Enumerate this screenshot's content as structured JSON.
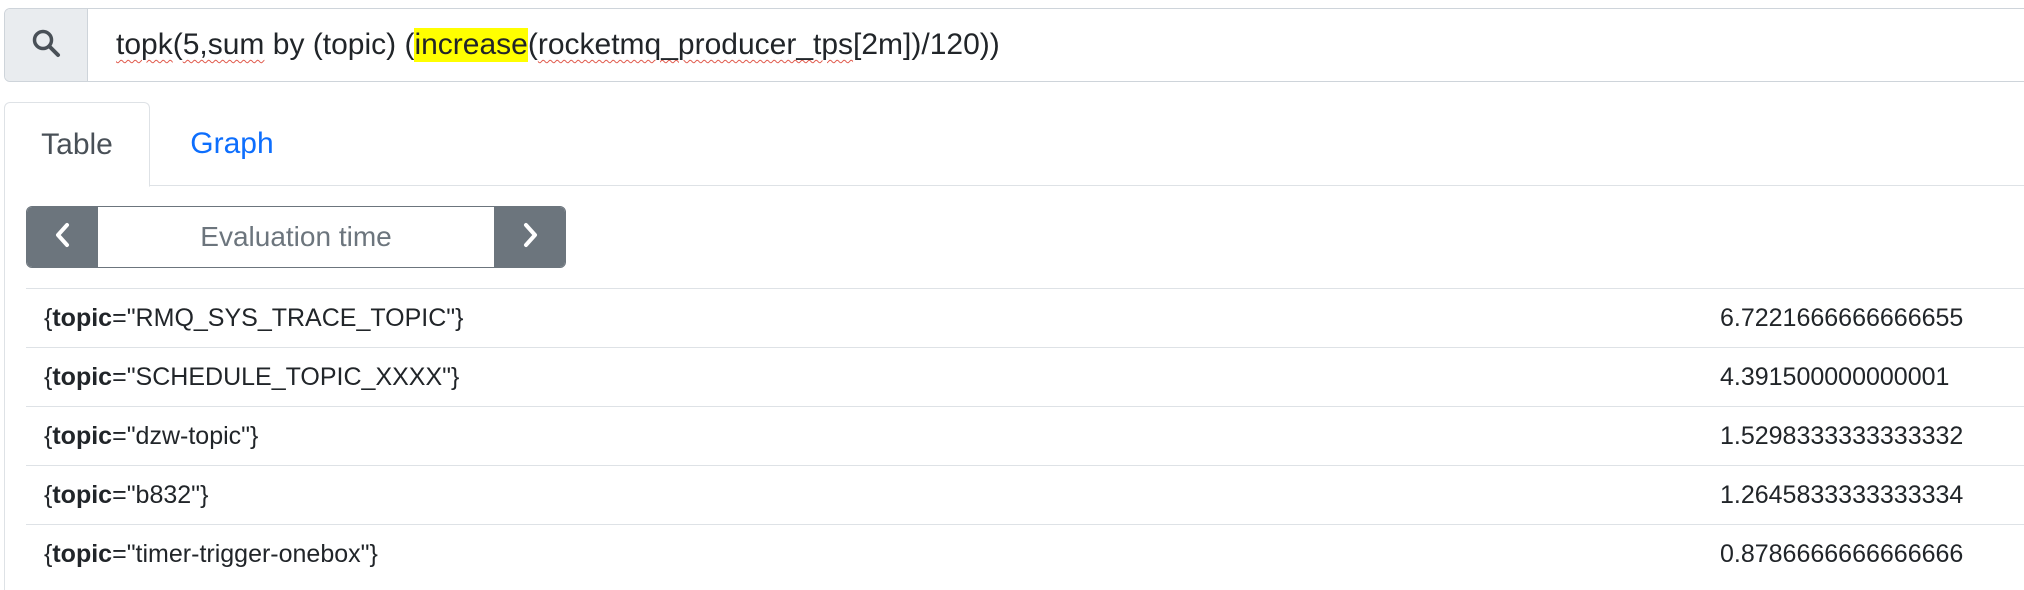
{
  "query": {
    "parts": [
      {
        "text": "topk",
        "style": "squig"
      },
      {
        "text": "(",
        "style": "plain"
      },
      {
        "text": "5,sum",
        "style": "squig"
      },
      {
        "text": " by (topic) (",
        "style": "plain"
      },
      {
        "text": "increase",
        "style": "hl"
      },
      {
        "text": "(",
        "style": "plain"
      },
      {
        "text": "rocketmq_producer_tps",
        "style": "squig"
      },
      {
        "text": "[2m])/120))",
        "style": "plain"
      }
    ]
  },
  "tabs": {
    "table": "Table",
    "graph": "Graph"
  },
  "eval": {
    "placeholder": "Evaluation time"
  },
  "results": [
    {
      "label": "topic",
      "value_text": "\"RMQ_SYS_TRACE_TOPIC\"",
      "number": "6.7221666666666655"
    },
    {
      "label": "topic",
      "value_text": "\"SCHEDULE_TOPIC_XXXX\"",
      "number": "4.391500000000001"
    },
    {
      "label": "topic",
      "value_text": "\"dzw-topic\"",
      "number": "1.5298333333333332"
    },
    {
      "label": "topic",
      "value_text": "\"b832\"",
      "number": "1.2645833333333334"
    },
    {
      "label": "topic",
      "value_text": "\"timer-trigger-onebox\"",
      "number": "0.8786666666666666"
    }
  ],
  "colors": {
    "accent": "#0d6efd",
    "highlight": "#ffff00",
    "button": "#6c757d"
  },
  "icons": {
    "search": "search-icon",
    "prev": "chevron-left-icon",
    "next": "chevron-right-icon"
  }
}
